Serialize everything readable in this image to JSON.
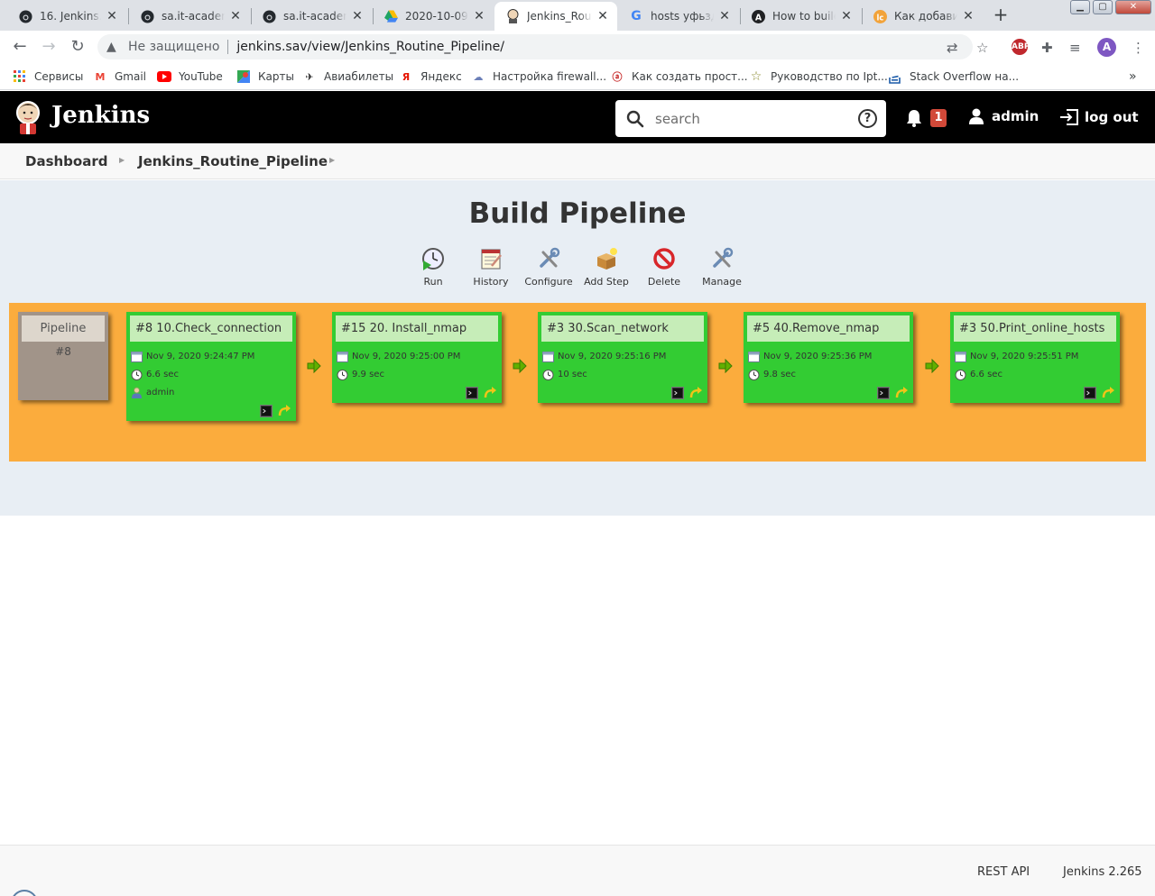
{
  "browser": {
    "tabs": [
      {
        "title": "16. Jenkins. R",
        "favicon": "github-icon"
      },
      {
        "title": "sa.it-academy",
        "favicon": "github-icon"
      },
      {
        "title": "sa.it-academy",
        "favicon": "github-icon"
      },
      {
        "title": "2020-10-09",
        "favicon": "google-drive-icon"
      },
      {
        "title": "Jenkins_Rout",
        "favicon": "jenkins-icon",
        "active": true
      },
      {
        "title": "hosts уфьзд",
        "favicon": "google-icon"
      },
      {
        "title": "How to build",
        "favicon": "a-icon"
      },
      {
        "title": "Как добавить",
        "favicon": "orange-circle-icon"
      }
    ],
    "insecure_label": "Не защищено",
    "url": "jenkins.sav/view/Jenkins_Routine_Pipeline/",
    "profile_initial": "A",
    "bookmarks": [
      {
        "label": "Сервисы",
        "icon": "apps-grid-icon"
      },
      {
        "label": "Gmail",
        "icon": "gmail-icon"
      },
      {
        "label": "YouTube",
        "icon": "youtube-icon"
      },
      {
        "label": "Карты",
        "icon": "maps-icon"
      },
      {
        "label": "Авиабилеты",
        "icon": "plane-icon"
      },
      {
        "label": "Яндекс",
        "icon": "yandex-icon"
      },
      {
        "label": "Настройка firewall...",
        "icon": "cloud-icon"
      },
      {
        "label": "Как создать прост...",
        "icon": "page-icon"
      },
      {
        "label": "Руководство по Ipt...",
        "icon": "star-icon"
      },
      {
        "label": "Stack Overflow на...",
        "icon": "stackoverflow-icon"
      }
    ]
  },
  "header": {
    "app_title": "Jenkins",
    "search_placeholder": "search",
    "notification_count": "1",
    "user": "admin",
    "logout": "log out"
  },
  "breadcrumb": [
    "Dashboard",
    "Jenkins_Routine_Pipeline"
  ],
  "main": {
    "title": "Build Pipeline",
    "actions": [
      {
        "label": "Run",
        "icon": "run-clock-icon"
      },
      {
        "label": "History",
        "icon": "history-notepad-icon"
      },
      {
        "label": "Configure",
        "icon": "configure-tools-icon"
      },
      {
        "label": "Add Step",
        "icon": "add-step-box-icon"
      },
      {
        "label": "Delete",
        "icon": "delete-no-entry-icon"
      },
      {
        "label": "Manage",
        "icon": "manage-tools-icon"
      }
    ],
    "pipeline": {
      "label": "Pipeline",
      "build": "#8",
      "stages": [
        {
          "title": "#8 10.Check_connection",
          "date": "Nov 9, 2020 9:24:47 PM",
          "duration": "6.6 sec",
          "user": "admin"
        },
        {
          "title": "#15 20. Install_nmap",
          "date": "Nov 9, 2020 9:25:00 PM",
          "duration": "9.9 sec"
        },
        {
          "title": "#3 30.Scan_network",
          "date": "Nov 9, 2020 9:25:16 PM",
          "duration": "10 sec"
        },
        {
          "title": "#5 40.Remove_nmap",
          "date": "Nov 9, 2020 9:25:36 PM",
          "duration": "9.8 sec"
        },
        {
          "title": "#3 50.Print_online_hosts",
          "date": "Nov 9, 2020 9:25:51 PM",
          "duration": "6.6 sec"
        }
      ]
    }
  },
  "footer": {
    "rest_api": "REST API",
    "version": "Jenkins 2.265"
  },
  "colors": {
    "pipeline_background": "#fbac3d",
    "stage_success": "#33cc33",
    "header": "#000000",
    "notification_badge": "#d24939"
  }
}
